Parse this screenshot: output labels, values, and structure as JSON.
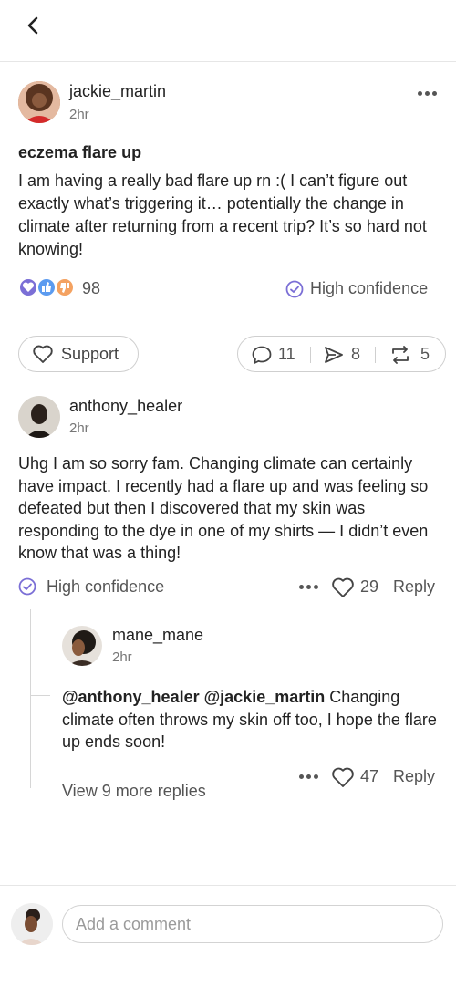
{
  "post": {
    "author": "jackie_martin",
    "time": "2hr",
    "title": "eczema flare up",
    "body": "I am having a really bad flare up rn :( I can’t figure out exactly what’s triggering it… potentially the change in climate after returning from a recent trip? It’s so hard not knowing!",
    "reaction_count": "98",
    "confidence_label": "High confidence",
    "support_label": "Support",
    "comments_count": "11",
    "shares_count": "8",
    "reposts_count": "5"
  },
  "comment": {
    "author": "anthony_healer",
    "time": "2hr",
    "body": "Uhg I am so sorry fam. Changing climate can certainly have impact. I recently had a flare up and was feeling so defeated but then I discovered that my skin was responding to the dye in one of my shirts —  I didn’t even know that was a thing!",
    "confidence_label": "High confidence",
    "likes": "29",
    "reply_label": "Reply"
  },
  "reply": {
    "author": "mane_mane",
    "time": "2hr",
    "mention1": "@anthony_healer",
    "mention2": "@jackie_martin",
    "body": "Changing climate often throws my skin off too, I hope the flare up ends soon!",
    "likes": "47",
    "reply_label": "Reply",
    "view_more": "View 9 more replies"
  },
  "composer": {
    "placeholder": "Add a comment"
  },
  "colors": {
    "accent_purple": "#7b6fd6",
    "reaction_heart": "#7b6fd6",
    "reaction_thumb": "#5b9bf0",
    "reaction_other": "#f4a261"
  }
}
